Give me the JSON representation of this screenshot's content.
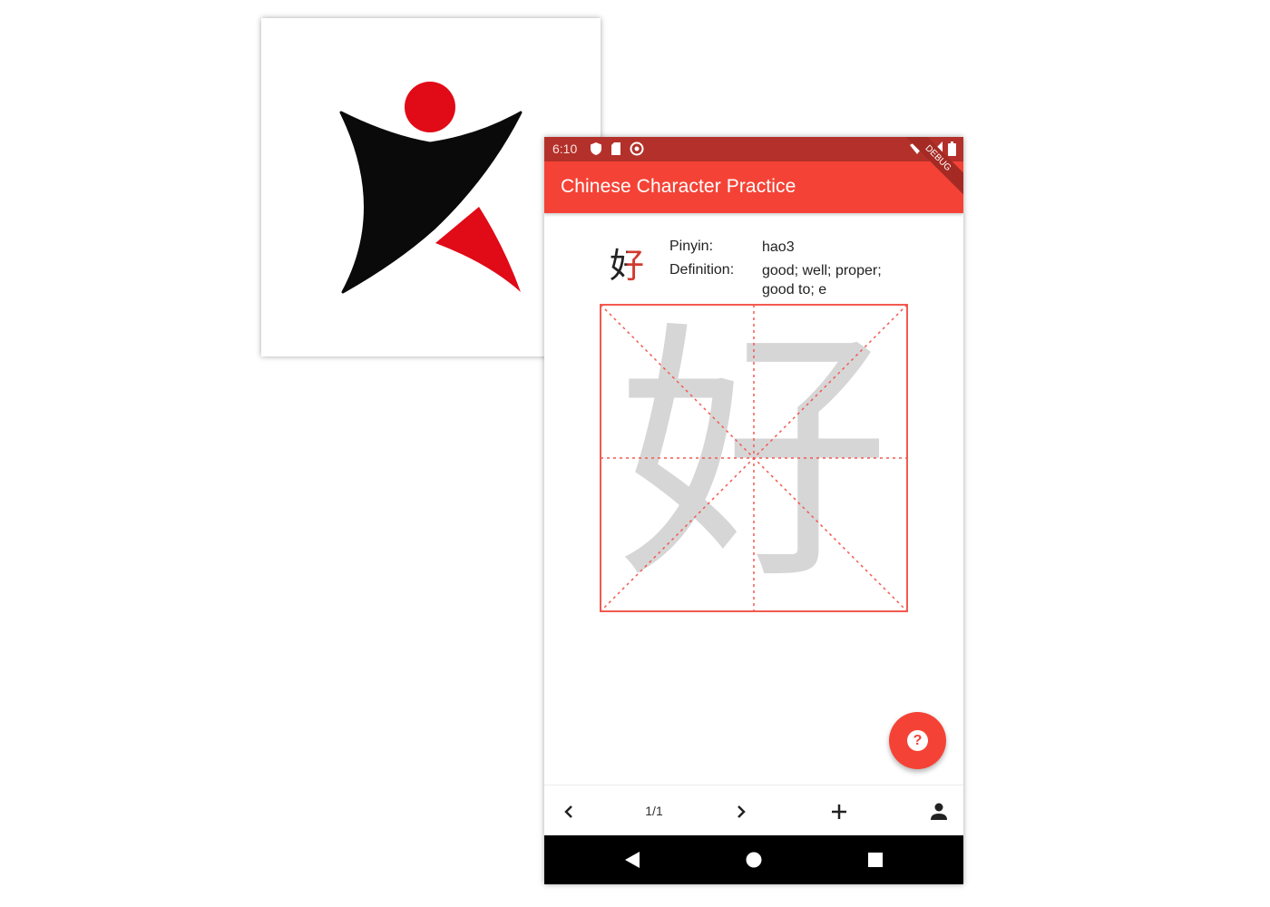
{
  "colors": {
    "primary": "#f44336",
    "status_bar": "#b3312a",
    "guide_line": "#f25a50",
    "ghost_character": "#d6d6d6"
  },
  "logo": {
    "icon": "running-figure-logo"
  },
  "status_bar": {
    "time": "6:10",
    "left_icons": [
      "shield-icon",
      "sd-card-icon",
      "sync-icon"
    ],
    "right_icons": [
      "wifi-icon",
      "signal-icon",
      "battery-icon"
    ]
  },
  "app_bar": {
    "title": "Chinese Character Practice",
    "debug_banner": "DEBUG"
  },
  "character_info": {
    "character": "好",
    "pinyin_label": "Pinyin:",
    "pinyin_value": "hao3",
    "definition_label": "Definition:",
    "definition_value": "good; well; proper; good to; e"
  },
  "practice_grid": {
    "ghost_character": "好"
  },
  "fab": {
    "icon": "help-icon",
    "label": "?"
  },
  "bottom_bar": {
    "prev_icon": "chevron-left-icon",
    "page_indicator": "1/1",
    "next_icon": "chevron-right-icon",
    "add_icon": "plus-icon",
    "profile_icon": "person-icon"
  },
  "nav_bar": {
    "back_icon": "back-triangle-icon",
    "home_icon": "home-circle-icon",
    "recents_icon": "recents-square-icon"
  }
}
